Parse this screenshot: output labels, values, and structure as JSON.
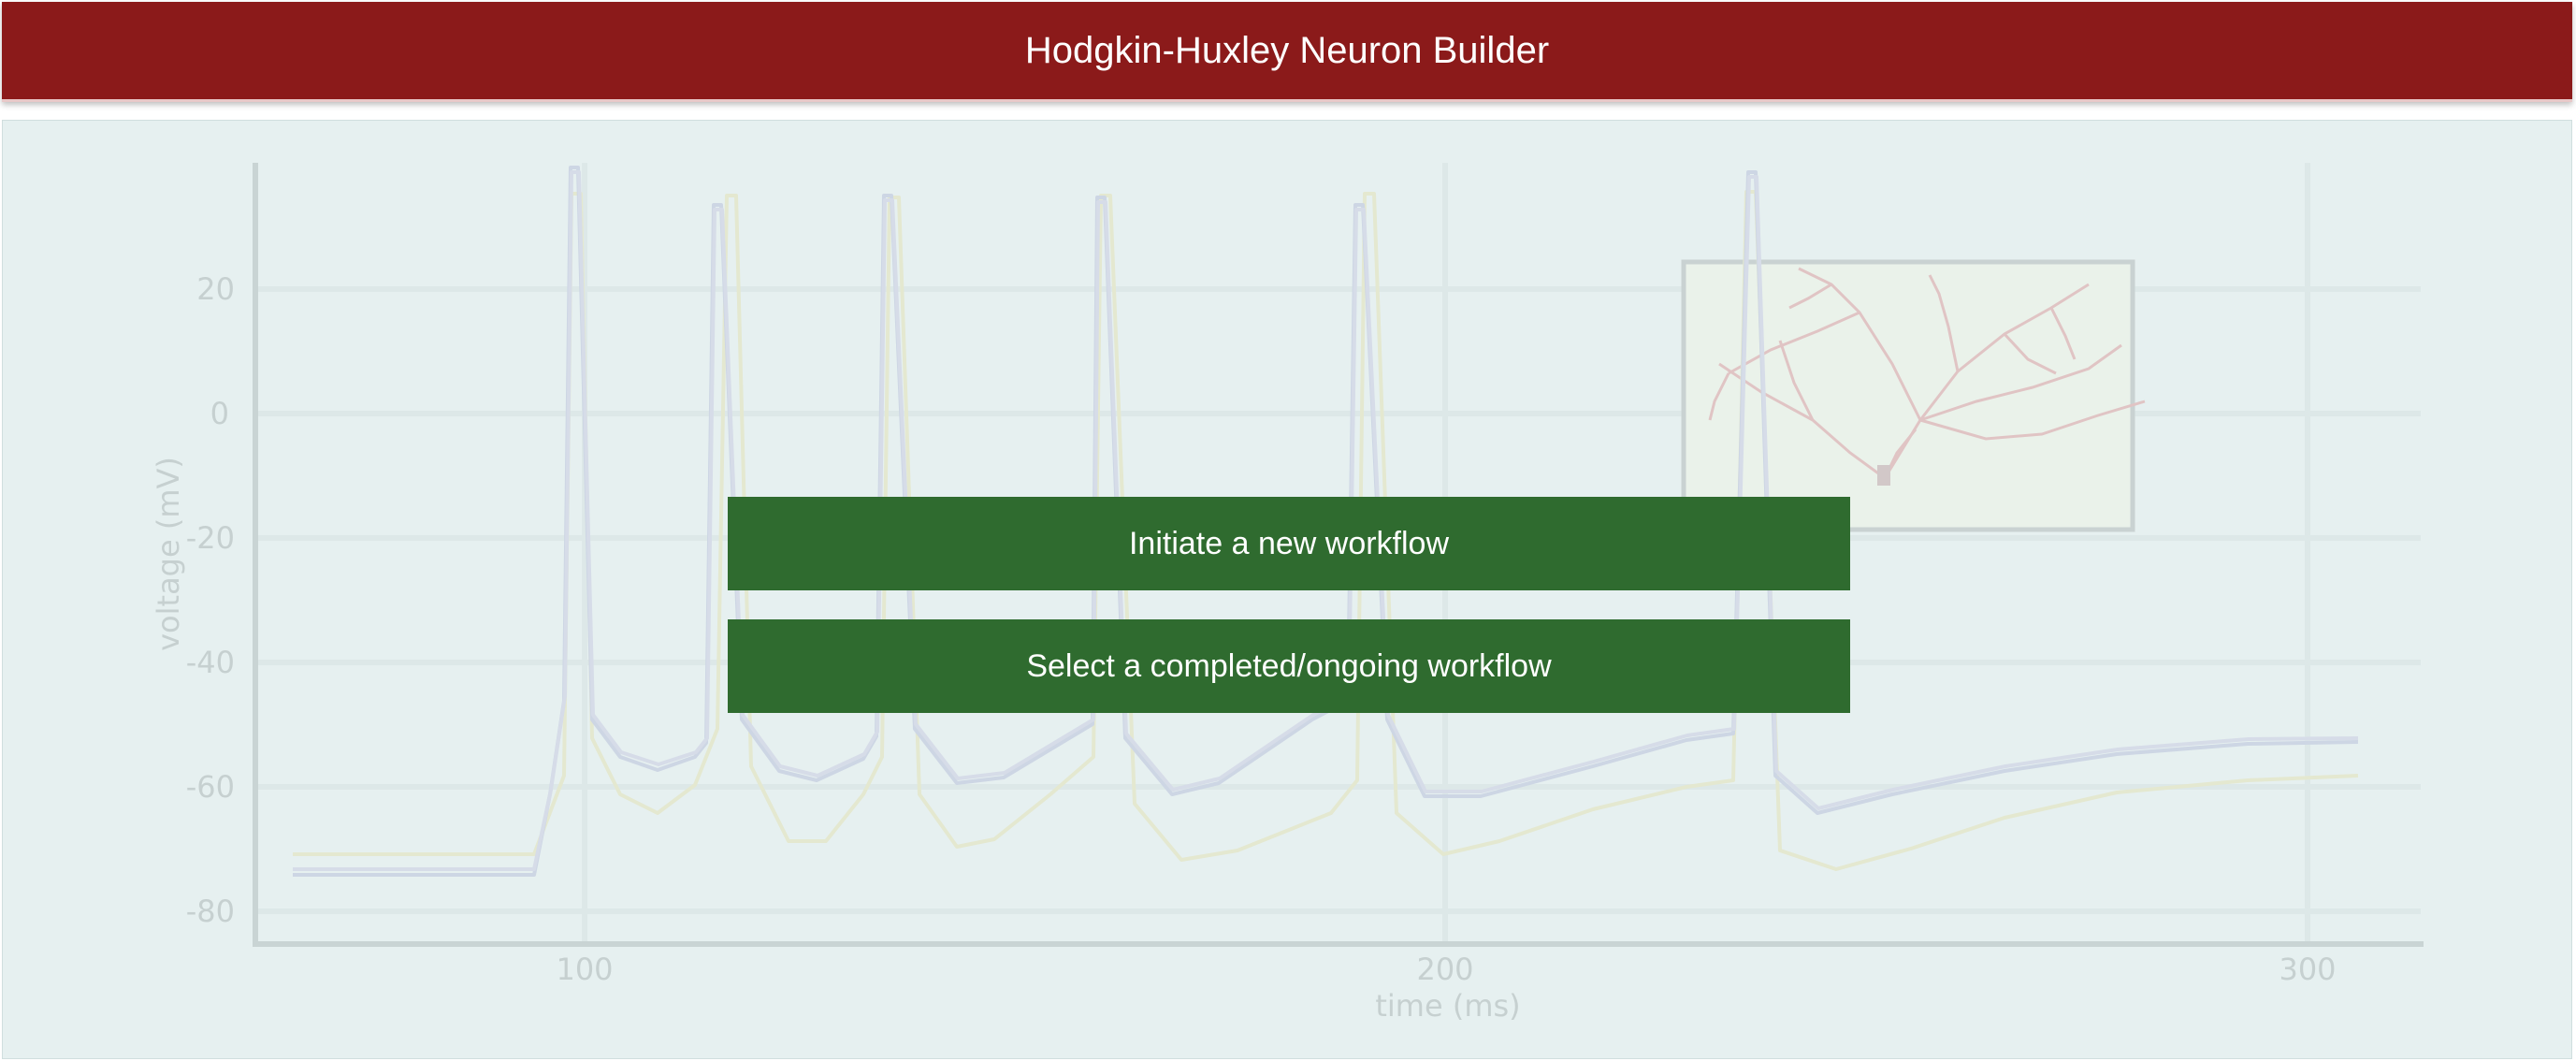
{
  "header": {
    "title": "Hodgkin-Huxley Neuron Builder"
  },
  "actions": {
    "new_workflow_label": "Initiate a new workflow",
    "select_workflow_label": "Select a completed/ongoing workflow"
  },
  "background_chart": {
    "y_label": "voltage (mV)",
    "x_label": "time (ms)",
    "y_ticks": [
      "20",
      "0",
      "-20",
      "-40",
      "-60",
      "-80"
    ],
    "x_ticks": [
      "100",
      "200",
      "300"
    ]
  },
  "colors": {
    "header_bg": "#8b1a1a",
    "button_bg": "#2f6b2f",
    "panel_bg": "#e6f0f0"
  }
}
